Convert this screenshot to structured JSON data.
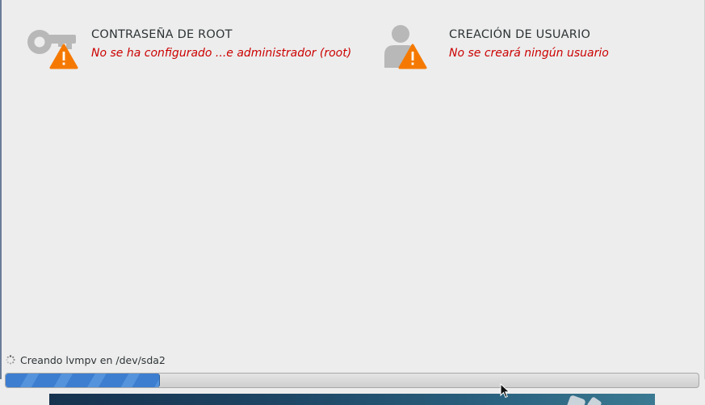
{
  "spokes": [
    {
      "title": "CONTRASEÑA DE ROOT",
      "status": "No se ha configurado ...e administrador (root)",
      "icon": "key-icon",
      "warning_icon": "warning-icon"
    },
    {
      "title": "CREACIÓN DE USUARIO",
      "status": "No se creará ningún usuario",
      "icon": "user-icon",
      "warning_icon": "warning-icon"
    }
  ],
  "install_progress": {
    "status_text": "Creando lvmpv en /dev/sda2",
    "fraction": 0.222
  },
  "colors": {
    "background": "#ededed",
    "warning_text": "#cc0000",
    "warning_badge": "#f57900",
    "icon_gray": "#b8b8b8",
    "progress_fill": "#3d7ed0"
  }
}
